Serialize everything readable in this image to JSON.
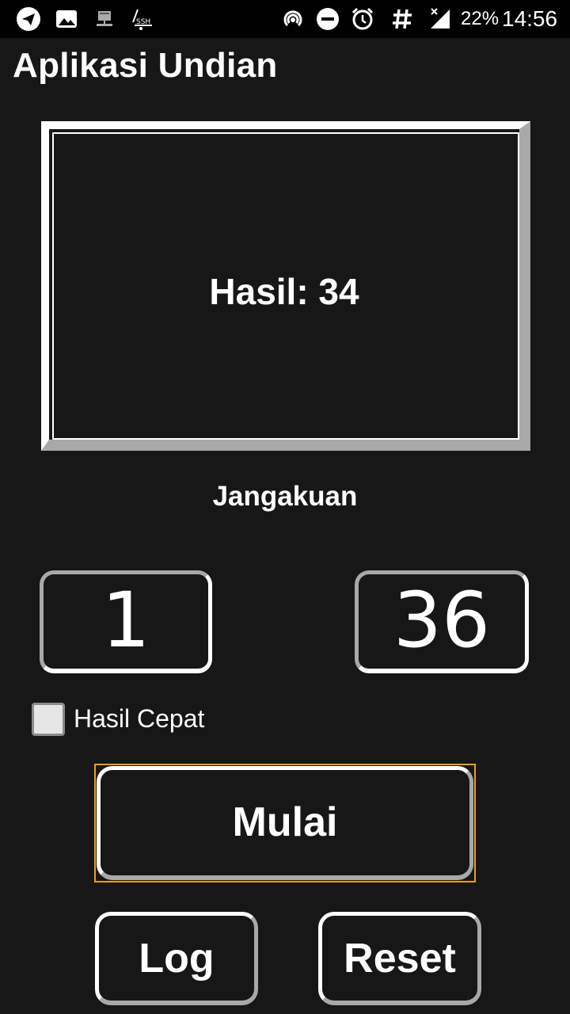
{
  "status_bar": {
    "battery": "22%",
    "time": "14:56",
    "left_icons": [
      "telegram-icon",
      "image-icon",
      "network-icon",
      "ssh-icon"
    ],
    "right_icons": [
      "hotspot-icon",
      "do-not-disturb-icon",
      "alarm-icon",
      "hash-icon",
      "signal-icon"
    ]
  },
  "app": {
    "title": "Aplikasi Undian"
  },
  "result": {
    "text": "Hasil: 34"
  },
  "range": {
    "label": "Jangakuan",
    "min_value": "1",
    "max_value": "36"
  },
  "options": {
    "quick_result_label": "Hasil Cepat",
    "quick_result_checked": false
  },
  "buttons": {
    "start": "Mulai",
    "log": "Log",
    "reset": "Reset"
  },
  "colors": {
    "background": "#171717",
    "status_bar": "#000000",
    "focus": "#f0a000",
    "bevel_light": "#ffffff",
    "bevel_dark": "#a8a8a8"
  }
}
